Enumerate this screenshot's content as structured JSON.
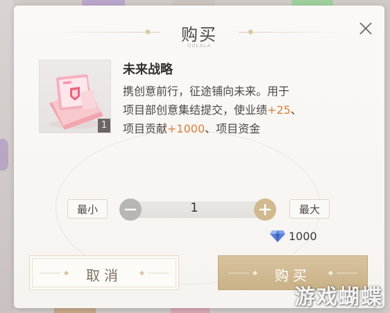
{
  "dialog": {
    "title": "购买",
    "title_sub": "DULALA",
    "close_icon": "close-icon"
  },
  "item": {
    "name": "未来战略",
    "count": "1",
    "desc_line1": "携创意前行，征途铺向未来。用于",
    "desc_line2_a": "项目部创意集结提交，使业绩",
    "desc_line2_hl": "+25",
    "desc_line2_b": "、",
    "desc_line3_a": "项目贡献",
    "desc_line3_hl": "+1000",
    "desc_line3_b": "、项目资金",
    "icon": "folder-document-icon"
  },
  "quantity": {
    "min_label": "最小",
    "max_label": "最大",
    "value": "1",
    "minus_icon": "minus-icon",
    "plus_icon": "plus-icon"
  },
  "price": {
    "amount": "1000",
    "currency_icon": "diamond-icon"
  },
  "buttons": {
    "cancel": "取消",
    "buy": "购买"
  },
  "watermark": "游戏蝴蝶",
  "colors": {
    "highlight": "#d8823c",
    "buy_button": "#c9b186",
    "plus_button": "#d1b98f",
    "minus_button": "#b8b6b2"
  }
}
